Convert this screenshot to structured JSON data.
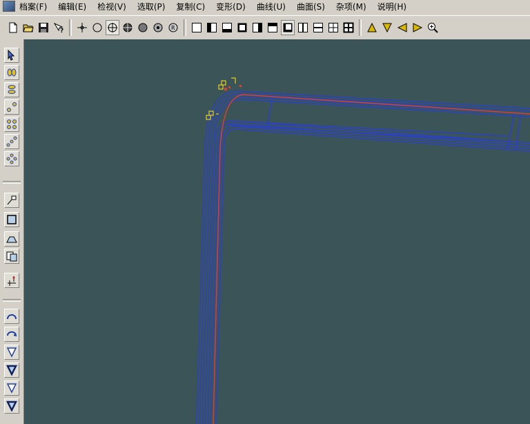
{
  "menu": {
    "items": [
      "档案(F)",
      "编辑(E)",
      "检视(V)",
      "选取(P)",
      "复制(C)",
      "变形(D)",
      "曲线(U)",
      "曲面(S)",
      "杂项(M)",
      "说明(H)"
    ]
  },
  "toolbar": {
    "file_buttons": [
      "new-file-icon",
      "open-folder-icon",
      "save-disk-icon",
      "whats-this-help-icon"
    ],
    "point_buttons": [
      "crosshair-point-icon",
      "circle-point-icon",
      "circle-cross-point-icon",
      "filled-cross-point-icon",
      "solid-sphere-point-icon",
      "dotted-sphere-point-icon",
      "r-sphere-point-icon"
    ],
    "view_buttons": [
      "view-full-icon",
      "view-left-half-icon",
      "view-bottom-half-icon",
      "view-frame-icon",
      "view-right-half-icon",
      "view-top-half-icon",
      "view-bottom-left-icon",
      "view-split-vertical-icon",
      "view-split-horizontal-icon",
      "view-four-quad-icon",
      "view-four-quad-bold-icon"
    ],
    "nav_buttons": [
      "triangle-up-icon",
      "triangle-down-icon",
      "triangle-left-icon",
      "triangle-right-icon",
      "zoom-in-icon"
    ],
    "pressed": [
      "circle-cross-point-icon",
      "view-bottom-left-icon"
    ],
    "accent_color": "#d8b800"
  },
  "sidebar": {
    "group1": [
      "select-arrow-icon",
      "point-pair-icon",
      "point-stack-icon",
      "diagonal-points-icon",
      "points-grid-icon",
      "points-line-icon",
      "points-ring-icon"
    ],
    "group2": [
      "flag-icon",
      "rect-select-icon",
      "arc-shape-icon",
      "doc-copy-icon",
      "move-axis-icon"
    ],
    "group3": [
      "arc-up-icon",
      "arc-hook-icon",
      "triangle-down-outline-icon",
      "triangle-down-bold-icon",
      "triangle-down-outline-icon",
      "triangle-down-bold-icon"
    ]
  },
  "viewport": {
    "background": "#3b5458",
    "curve_color": "#2a3fd0",
    "highlight_color": "#e04030",
    "marker_color": "#e8d020"
  }
}
